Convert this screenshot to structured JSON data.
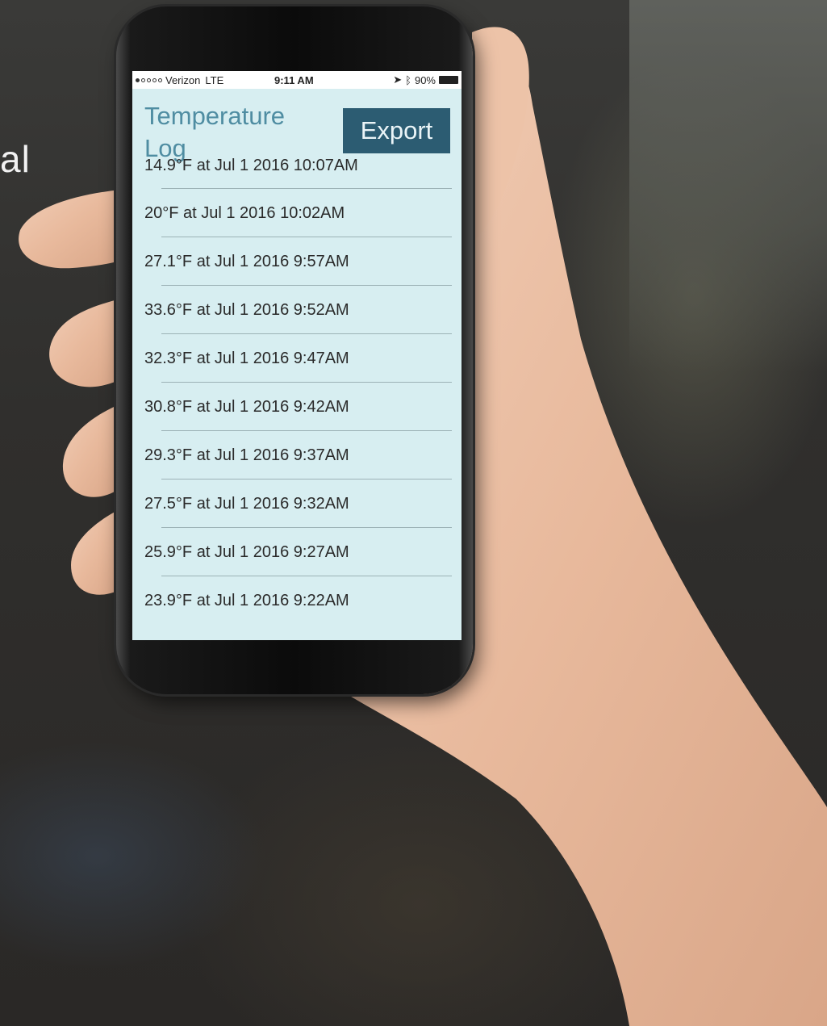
{
  "background": {
    "partial_text": "al"
  },
  "status_bar": {
    "carrier": "Verizon",
    "network": "LTE",
    "time": "9:11 AM",
    "battery": "90%"
  },
  "app": {
    "title": "Temperature Log",
    "export_label": "Export"
  },
  "log_entries": [
    "14.9°F at Jul  1 2016 10:07AM",
    "20°F at Jul  1 2016 10:02AM",
    "27.1°F at Jul  1 2016  9:57AM",
    "33.6°F at Jul  1 2016  9:52AM",
    "32.3°F at Jul  1 2016  9:47AM",
    "30.8°F at Jul  1 2016  9:42AM",
    "29.3°F at Jul  1 2016  9:37AM",
    "27.5°F at Jul  1 2016  9:32AM",
    "25.9°F at Jul  1 2016  9:27AM",
    "23.9°F at Jul  1 2016  9:22AM"
  ],
  "colors": {
    "screen_bg": "#d7eef1",
    "title": "#4f8da2",
    "export_bg": "#2c5c72"
  }
}
